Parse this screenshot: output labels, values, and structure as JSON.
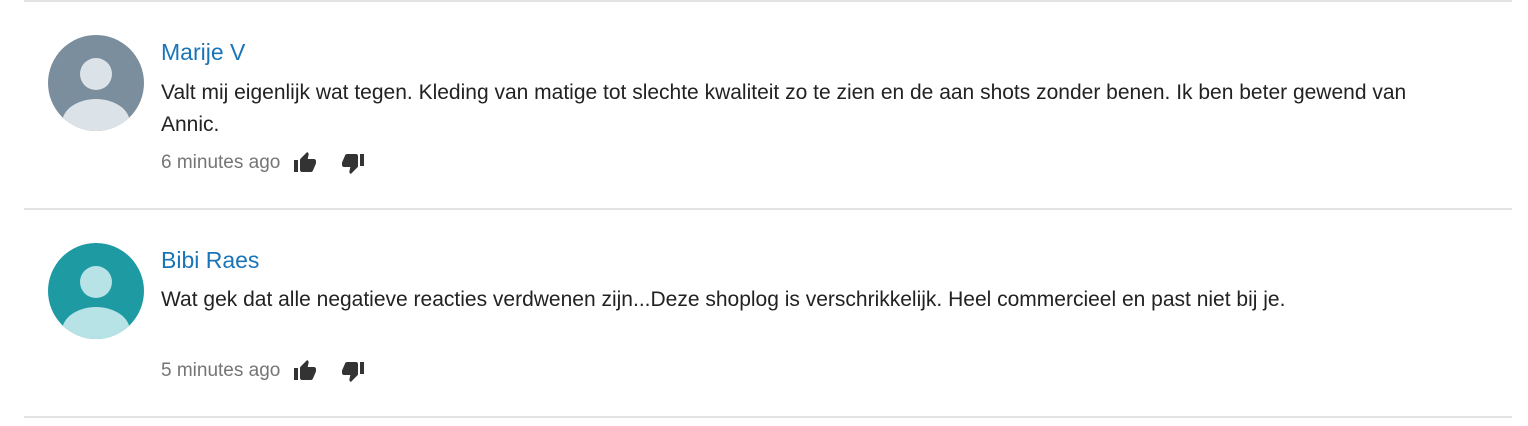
{
  "comments": [
    {
      "author": "Marije V",
      "text": "Valt mij eigenlijk wat tegen. Kleding van matige tot slechte kwaliteit zo te zien en de aan shots zonder benen. Ik ben beter gewend van Annic.",
      "timestamp": "6 minutes ago",
      "avatar_color": "#7b8e9e",
      "avatar_figure_color": "#dce3e8"
    },
    {
      "author": "Bibi Raes",
      "text": "Wat gek dat alle negatieve reacties verdwenen zijn...Deze shoplog is verschrikkelijk. Heel commercieel en past niet bij je.",
      "timestamp": "5 minutes ago",
      "avatar_color": "#1e9aa3",
      "avatar_figure_color": "#b8e3e6"
    }
  ],
  "icons": {
    "upvote": "thumbs-up-icon",
    "downvote": "thumbs-down-icon"
  },
  "colors": {
    "author_link": "#1a75b8",
    "body_text": "#222222",
    "meta_text": "#757575",
    "divider": "#e3e3e3"
  }
}
